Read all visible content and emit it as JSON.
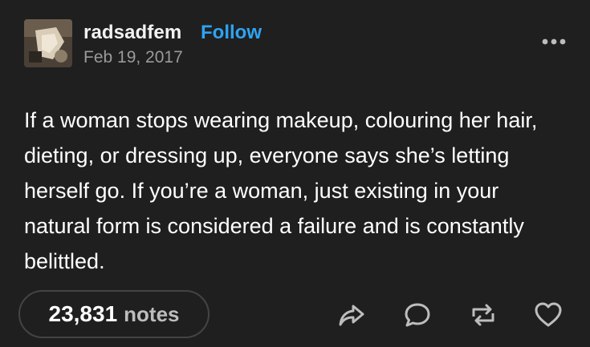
{
  "post": {
    "username": "radsadfem",
    "follow_label": "Follow",
    "date": "Feb 19, 2017",
    "body": "If a woman stops wearing makeup, colouring her hair, dieting, or dressing up, everyone says she’s letting herself go. If you’re a woman, just existing in your natural form is considered a failure and is constantly belittled.",
    "notes_count": "23,831",
    "notes_label": "notes"
  },
  "icons": {
    "more": "more-horizontal-icon",
    "share": "share-icon",
    "reply": "reply-icon",
    "reblog": "reblog-icon",
    "like": "heart-icon"
  },
  "colors": {
    "background": "#1f1f1f",
    "follow": "#2ea3f2",
    "date": "#9a9a9a",
    "text": "#ffffff"
  }
}
